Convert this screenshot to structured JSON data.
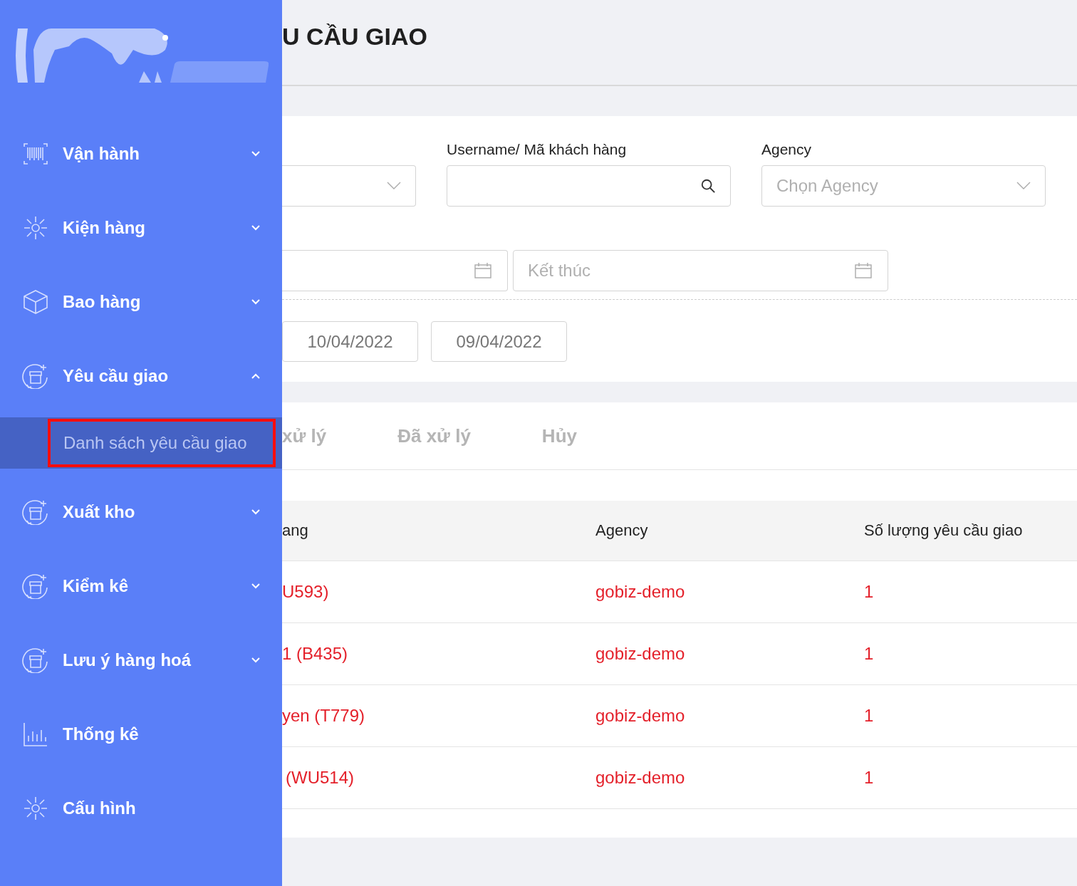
{
  "sidebar": {
    "items": [
      {
        "label": "Vận hành",
        "kind": "group",
        "expanded": false
      },
      {
        "label": "Kiện hàng",
        "kind": "group",
        "expanded": false
      },
      {
        "label": "Bao hàng",
        "kind": "group",
        "expanded": false
      },
      {
        "label": "Yêu cầu giao",
        "kind": "group",
        "expanded": true,
        "children": [
          {
            "label": "Danh sách yêu cầu giao",
            "selected": true
          }
        ]
      },
      {
        "label": "Xuất kho",
        "kind": "group",
        "expanded": false
      },
      {
        "label": "Kiểm kê",
        "kind": "group",
        "expanded": false
      },
      {
        "label": "Lưu ý hàng hoá",
        "kind": "group",
        "expanded": false
      },
      {
        "label": "Thống kê",
        "kind": "link"
      },
      {
        "label": "Cấu hình",
        "kind": "link"
      }
    ]
  },
  "header": {
    "title": "U CẦU GIAO"
  },
  "filters": {
    "row_1": [
      {
        "kind": "select"
      },
      {
        "kind": "search",
        "label": "Username/ Mã khách hàng"
      },
      {
        "kind": "select",
        "label": "Agency",
        "placeholder": "Chọn Agency"
      }
    ],
    "date_range": [
      {
        "kind": "date"
      },
      {
        "kind": "date",
        "placeholder": "Kết thúc"
      }
    ],
    "quick_dates": [
      "10/04/2022",
      "09/04/2022"
    ]
  },
  "tabs": [
    {
      "label": "xử lý",
      "selected": false
    },
    {
      "label": "Đã xử lý",
      "selected": false
    },
    {
      "label": "Hủy",
      "selected": false
    }
  ],
  "table": {
    "columns": [
      "ang",
      "Agency",
      "Số lượng yêu cầu giao"
    ],
    "rows": [
      [
        "U593)",
        "gobiz-demo",
        "1"
      ],
      [
        "1 (B435)",
        "gobiz-demo",
        "1"
      ],
      [
        "yen (T779)",
        "gobiz-demo",
        "1"
      ],
      [
        "(WU514)",
        "gobiz-demo",
        "1"
      ]
    ]
  }
}
